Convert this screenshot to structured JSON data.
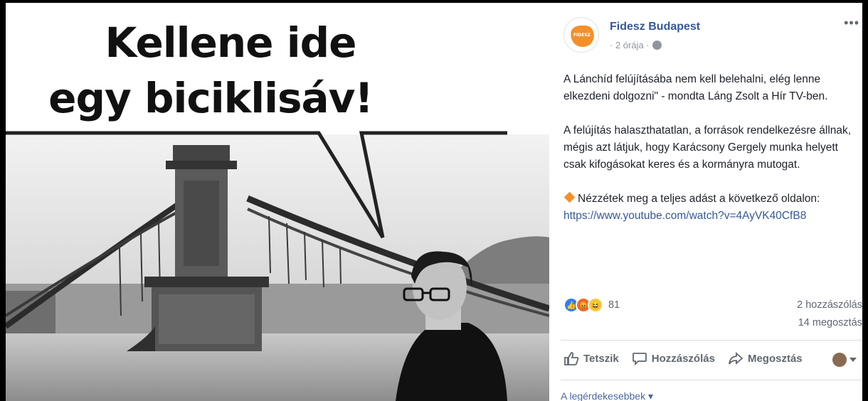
{
  "photo": {
    "headline_line1": "Kellene ide",
    "headline_line2": "egy biciklisáv!"
  },
  "post": {
    "page_name": "Fidesz Budapest",
    "logo_text": "FIDESZ",
    "time": "· 2 órája ·",
    "paragraph1": "A Lánchíd felújításába nem kell belehalni, elég lenne elkezdeni dolgozni\" - mondta Láng Zsolt a Hír TV-ben.",
    "paragraph2": "A felújítás halaszthatatlan, a források rendelkezésre állnak, mégis azt látjuk, hogy Karácsony Gergely munka helyett csak kifogásokat keres és a kormányra mutogat.",
    "paragraph3": "Nézzétek meg a teljes adást a következő oldalon:",
    "link": "https://www.youtube.com/watch?v=4AyVK40CfB8",
    "reaction_count": "81",
    "comments": "2 hozzászólás",
    "shares": "14 megosztás",
    "like_label": "Tetszik",
    "comment_label": "Hozzászólás",
    "share_label": "Megosztás",
    "sort_label": "A legérdekesebbek ▾"
  },
  "colors": {
    "brand_link": "#365899",
    "logo_orange": "#f4902b",
    "like_blue": "#2e7ff1"
  }
}
